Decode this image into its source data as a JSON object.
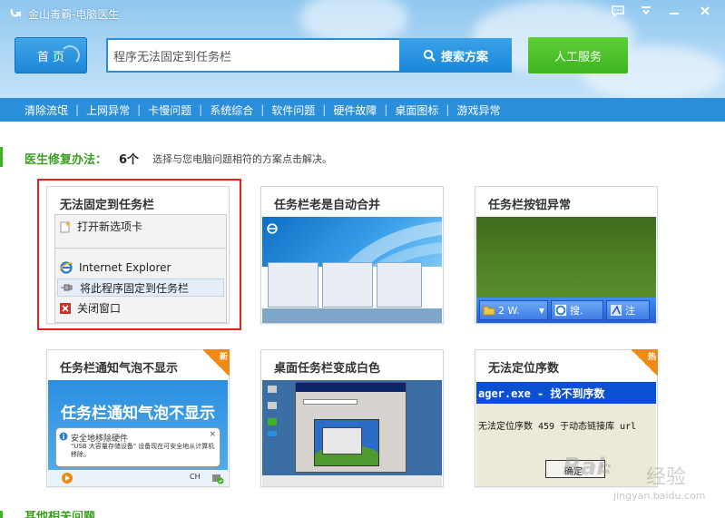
{
  "window": {
    "title": "金山毒霸-电脑医生",
    "controls": [
      "chat-icon",
      "menu-icon",
      "minimize-icon",
      "close-icon"
    ]
  },
  "header": {
    "home_label": "首 页",
    "search_value": "程序无法固定到任务栏",
    "search_button": "搜索方案",
    "service_button": "人工服务"
  },
  "nav": {
    "items": [
      "清除流氓",
      "上网异常",
      "卡慢问题",
      "系统综合",
      "软件问题",
      "硬件故障",
      "桌面图标",
      "游戏异常"
    ]
  },
  "section": {
    "title": "医生修复办法：",
    "count": "6个",
    "description": "选择与您电脑问题相符的方案点击解决。"
  },
  "cards": [
    {
      "title": "无法固定到任务栏",
      "highlighted": true,
      "menu": {
        "item1": "打开新选项卡",
        "item2": "Internet Explorer",
        "item3": "将此程序固定到任务栏",
        "item4": "关闭窗口"
      }
    },
    {
      "title": "任务栏老是自动合并"
    },
    {
      "title": "任务栏按钮异常",
      "taskbar": {
        "btn1": "2 W.",
        "btn2": "搜.",
        "btn3": "注"
      }
    },
    {
      "title": "任务栏通知气泡不显示",
      "badge": "新",
      "thumb_text": "任务栏通知气泡不显示",
      "balloon_title": "安全地移除硬件",
      "balloon_desc": "\"USB 大容量存储设备\" 设备现在可安全地从计算机移除。",
      "tray": "CH"
    },
    {
      "title": "桌面任务栏变成白色"
    },
    {
      "title": "无法定位序数",
      "badge": "热",
      "error_title": "ager.exe - 找不到序数",
      "error_msg": "无法定位序数 459 于动态链接库 url",
      "ok_label": "确定"
    }
  ],
  "watermark": {
    "brand": "Bai",
    "brand2": "经验",
    "url": "jingyan.baidu.com"
  },
  "bottom_section": {
    "title": "其他相关问题"
  },
  "colors": {
    "header_blue": "#2a8edb",
    "accent_green": "#3db420",
    "highlight_red": "#e3211f",
    "badge_orange": "#f08a16"
  }
}
